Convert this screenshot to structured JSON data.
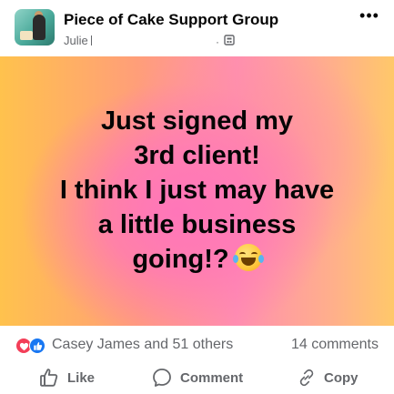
{
  "header": {
    "group_name": "Piece of Cake Support Group",
    "author": "Julie",
    "dot": "·",
    "avatar_icon": "group-avatar-icon",
    "privacy_icon": "group-privacy-icon",
    "more_icon": "more-options-icon",
    "more_label": "•••"
  },
  "post": {
    "lines": [
      "Just signed my",
      "3rd client!",
      "I think I just may have",
      "a little business",
      "going!?"
    ],
    "emoji": "face-with-tears-of-joy",
    "background": {
      "orange": "#ffc24d",
      "pink": "#ff76b9"
    }
  },
  "reactions": {
    "icons": [
      "love-icon",
      "like-icon"
    ],
    "summary": "Casey James and 51 others",
    "comments": "14 comments"
  },
  "actions": {
    "like_label": "Like",
    "comment_label": "Comment",
    "copy_label": "Copy"
  },
  "colors": {
    "text_primary": "#050505",
    "text_secondary": "#65676b",
    "like_blue": "#1877f2",
    "love_red": "#f33e58"
  }
}
